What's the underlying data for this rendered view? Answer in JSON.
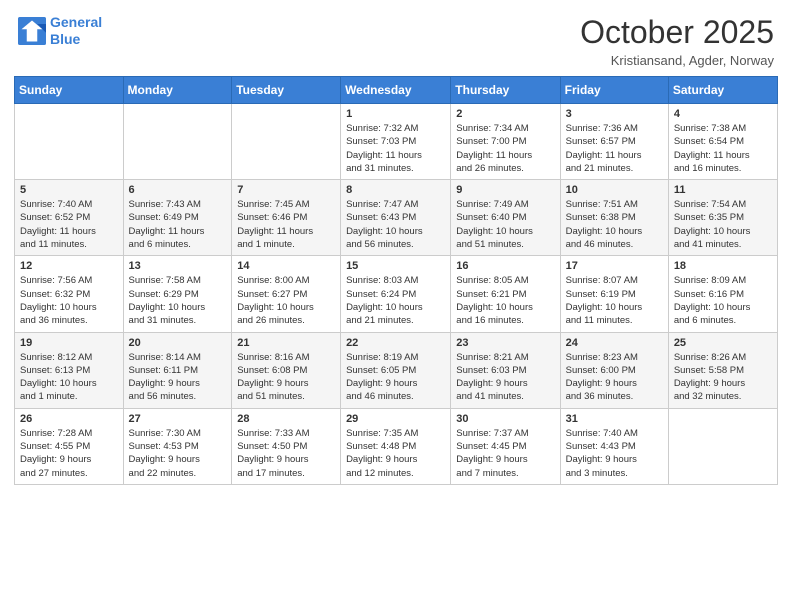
{
  "header": {
    "logo_line1": "General",
    "logo_line2": "Blue",
    "month": "October 2025",
    "location": "Kristiansand, Agder, Norway"
  },
  "weekdays": [
    "Sunday",
    "Monday",
    "Tuesday",
    "Wednesday",
    "Thursday",
    "Friday",
    "Saturday"
  ],
  "weeks": [
    [
      {
        "day": "",
        "info": ""
      },
      {
        "day": "",
        "info": ""
      },
      {
        "day": "",
        "info": ""
      },
      {
        "day": "1",
        "info": "Sunrise: 7:32 AM\nSunset: 7:03 PM\nDaylight: 11 hours\nand 31 minutes."
      },
      {
        "day": "2",
        "info": "Sunrise: 7:34 AM\nSunset: 7:00 PM\nDaylight: 11 hours\nand 26 minutes."
      },
      {
        "day": "3",
        "info": "Sunrise: 7:36 AM\nSunset: 6:57 PM\nDaylight: 11 hours\nand 21 minutes."
      },
      {
        "day": "4",
        "info": "Sunrise: 7:38 AM\nSunset: 6:54 PM\nDaylight: 11 hours\nand 16 minutes."
      }
    ],
    [
      {
        "day": "5",
        "info": "Sunrise: 7:40 AM\nSunset: 6:52 PM\nDaylight: 11 hours\nand 11 minutes."
      },
      {
        "day": "6",
        "info": "Sunrise: 7:43 AM\nSunset: 6:49 PM\nDaylight: 11 hours\nand 6 minutes."
      },
      {
        "day": "7",
        "info": "Sunrise: 7:45 AM\nSunset: 6:46 PM\nDaylight: 11 hours\nand 1 minute."
      },
      {
        "day": "8",
        "info": "Sunrise: 7:47 AM\nSunset: 6:43 PM\nDaylight: 10 hours\nand 56 minutes."
      },
      {
        "day": "9",
        "info": "Sunrise: 7:49 AM\nSunset: 6:40 PM\nDaylight: 10 hours\nand 51 minutes."
      },
      {
        "day": "10",
        "info": "Sunrise: 7:51 AM\nSunset: 6:38 PM\nDaylight: 10 hours\nand 46 minutes."
      },
      {
        "day": "11",
        "info": "Sunrise: 7:54 AM\nSunset: 6:35 PM\nDaylight: 10 hours\nand 41 minutes."
      }
    ],
    [
      {
        "day": "12",
        "info": "Sunrise: 7:56 AM\nSunset: 6:32 PM\nDaylight: 10 hours\nand 36 minutes."
      },
      {
        "day": "13",
        "info": "Sunrise: 7:58 AM\nSunset: 6:29 PM\nDaylight: 10 hours\nand 31 minutes."
      },
      {
        "day": "14",
        "info": "Sunrise: 8:00 AM\nSunset: 6:27 PM\nDaylight: 10 hours\nand 26 minutes."
      },
      {
        "day": "15",
        "info": "Sunrise: 8:03 AM\nSunset: 6:24 PM\nDaylight: 10 hours\nand 21 minutes."
      },
      {
        "day": "16",
        "info": "Sunrise: 8:05 AM\nSunset: 6:21 PM\nDaylight: 10 hours\nand 16 minutes."
      },
      {
        "day": "17",
        "info": "Sunrise: 8:07 AM\nSunset: 6:19 PM\nDaylight: 10 hours\nand 11 minutes."
      },
      {
        "day": "18",
        "info": "Sunrise: 8:09 AM\nSunset: 6:16 PM\nDaylight: 10 hours\nand 6 minutes."
      }
    ],
    [
      {
        "day": "19",
        "info": "Sunrise: 8:12 AM\nSunset: 6:13 PM\nDaylight: 10 hours\nand 1 minute."
      },
      {
        "day": "20",
        "info": "Sunrise: 8:14 AM\nSunset: 6:11 PM\nDaylight: 9 hours\nand 56 minutes."
      },
      {
        "day": "21",
        "info": "Sunrise: 8:16 AM\nSunset: 6:08 PM\nDaylight: 9 hours\nand 51 minutes."
      },
      {
        "day": "22",
        "info": "Sunrise: 8:19 AM\nSunset: 6:05 PM\nDaylight: 9 hours\nand 46 minutes."
      },
      {
        "day": "23",
        "info": "Sunrise: 8:21 AM\nSunset: 6:03 PM\nDaylight: 9 hours\nand 41 minutes."
      },
      {
        "day": "24",
        "info": "Sunrise: 8:23 AM\nSunset: 6:00 PM\nDaylight: 9 hours\nand 36 minutes."
      },
      {
        "day": "25",
        "info": "Sunrise: 8:26 AM\nSunset: 5:58 PM\nDaylight: 9 hours\nand 32 minutes."
      }
    ],
    [
      {
        "day": "26",
        "info": "Sunrise: 7:28 AM\nSunset: 4:55 PM\nDaylight: 9 hours\nand 27 minutes."
      },
      {
        "day": "27",
        "info": "Sunrise: 7:30 AM\nSunset: 4:53 PM\nDaylight: 9 hours\nand 22 minutes."
      },
      {
        "day": "28",
        "info": "Sunrise: 7:33 AM\nSunset: 4:50 PM\nDaylight: 9 hours\nand 17 minutes."
      },
      {
        "day": "29",
        "info": "Sunrise: 7:35 AM\nSunset: 4:48 PM\nDaylight: 9 hours\nand 12 minutes."
      },
      {
        "day": "30",
        "info": "Sunrise: 7:37 AM\nSunset: 4:45 PM\nDaylight: 9 hours\nand 7 minutes."
      },
      {
        "day": "31",
        "info": "Sunrise: 7:40 AM\nSunset: 4:43 PM\nDaylight: 9 hours\nand 3 minutes."
      },
      {
        "day": "",
        "info": ""
      }
    ]
  ]
}
